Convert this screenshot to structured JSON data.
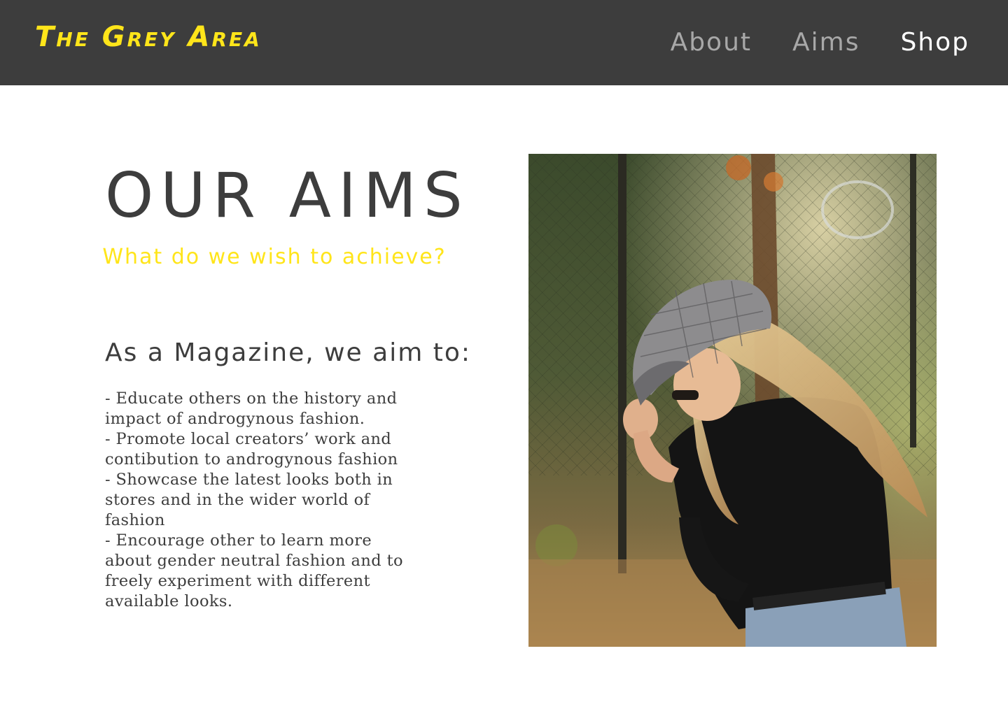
{
  "header": {
    "logo": "The Grey Area",
    "nav": [
      {
        "label": "About",
        "active": false
      },
      {
        "label": "Aims",
        "active": false
      },
      {
        "label": "Shop",
        "active": true
      }
    ],
    "background_color": "#3d3d3d",
    "logo_color": "#ffe51a"
  },
  "main": {
    "title": "OUR AIMS",
    "subtitle": "What do we wish to achieve?",
    "section_heading": "As a Magazine, we aim to:",
    "aims": [
      "- Educate others on the history and",
      "impact of androgynous fashion.",
      "- Promote local creators’ work and",
      "contibution to androgynous fashion",
      "- Showcase the latest looks both in",
      "stores and in the wider world of",
      "fashion",
      "- Encourage other to learn more",
      "about gender neutral fashion and to",
      "freely experiment with different",
      "available looks."
    ],
    "photo": {
      "subject": "photo-woman-in-plaid-cap"
    }
  },
  "colors": {
    "accent": "#ffe51a",
    "text": "#3d3d3d",
    "nav_inactive": "#a8a8a8",
    "nav_active": "#ffffff"
  }
}
